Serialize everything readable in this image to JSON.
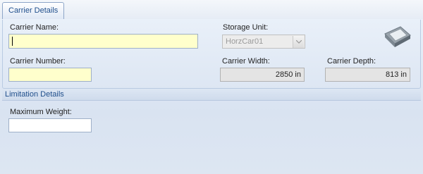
{
  "tabs": [
    {
      "label": "Carrier Details"
    }
  ],
  "carrier": {
    "name_label": "Carrier Name:",
    "name_value": "",
    "number_label": "Carrier Number:",
    "number_value": "",
    "storage_unit_label": "Storage Unit:",
    "storage_unit_value": "HorzCar01",
    "width_label": "Carrier Width:",
    "width_value": "2850 in",
    "depth_label": "Carrier Depth:",
    "depth_value": "813 in"
  },
  "limitation": {
    "section_title": "Limitation Details",
    "max_weight_label": "Maximum Weight:",
    "max_weight_value": ""
  },
  "icons": {
    "carrier": "carrier-tray-icon",
    "dropdown": "chevron-down-icon"
  },
  "colors": {
    "required_field": "#ffffcc",
    "tab_text": "#1e4e8c",
    "section_title": "#1f4e8b"
  }
}
